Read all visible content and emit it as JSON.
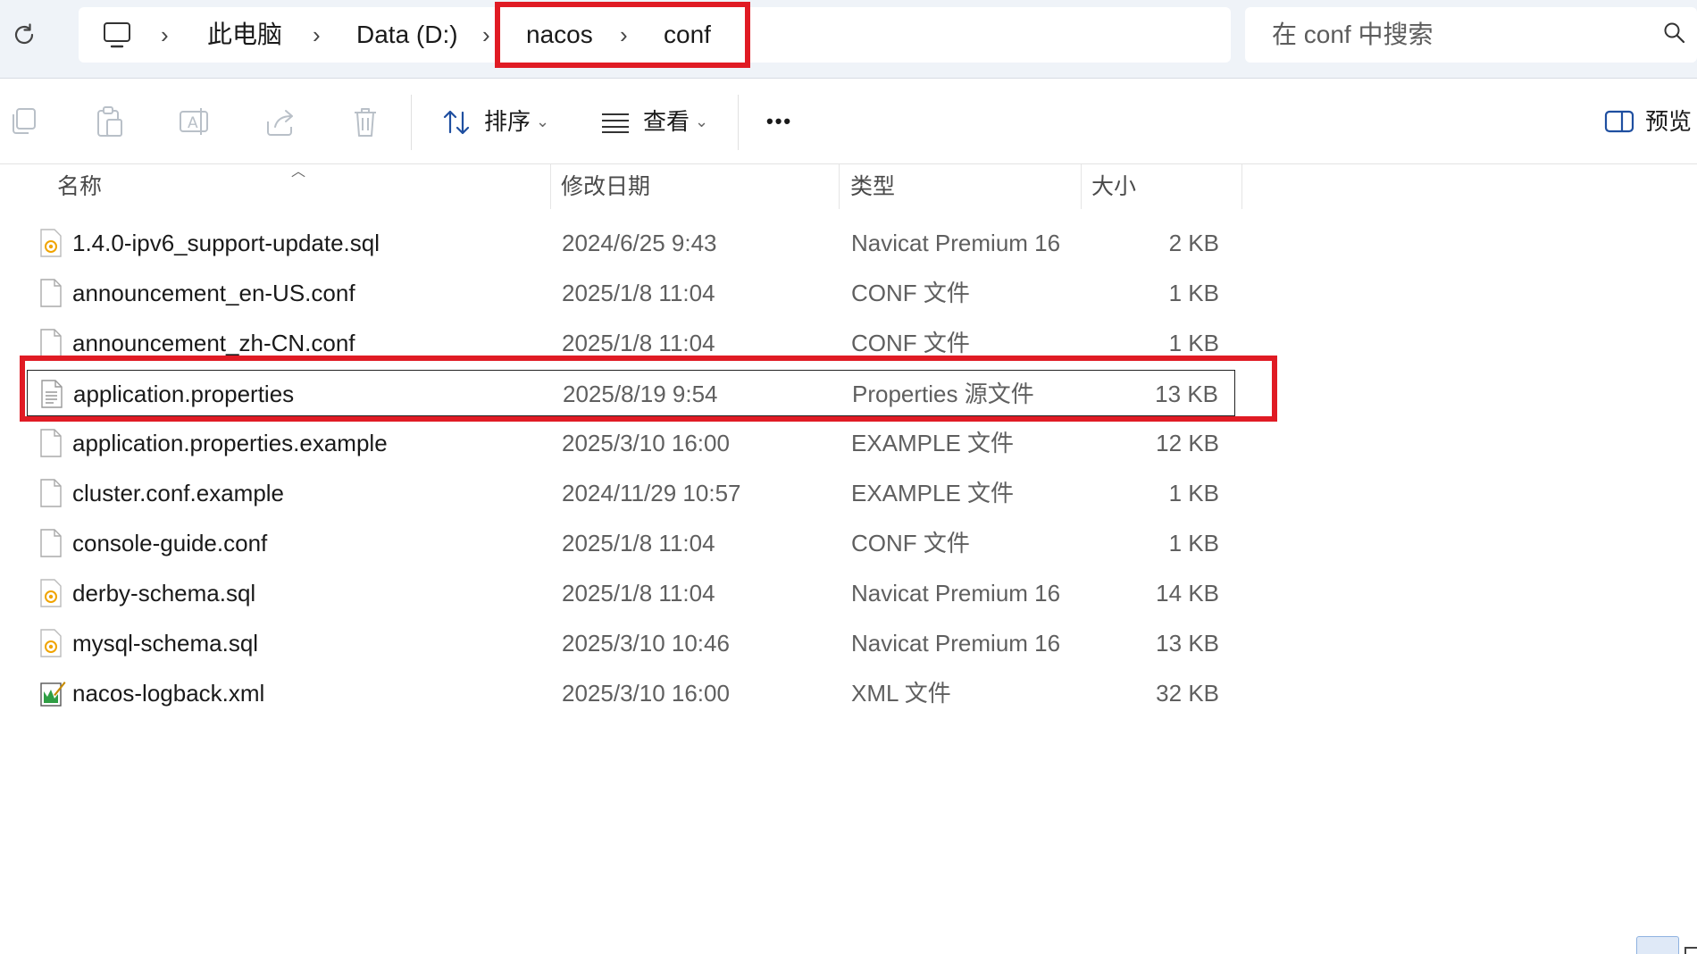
{
  "breadcrumb": {
    "items": [
      "此电脑",
      "Data (D:)",
      "nacos",
      "conf"
    ]
  },
  "search": {
    "placeholder": "在 conf 中搜索"
  },
  "toolbar": {
    "sort_label": "排序",
    "view_label": "查看",
    "more_label": "•••",
    "preview_label": "预览"
  },
  "columns": {
    "name": "名称",
    "date": "修改日期",
    "type": "类型",
    "size": "大小"
  },
  "files": [
    {
      "name": "1.4.0-ipv6_support-update.sql",
      "date": "2024/6/25 9:43",
      "type": "Navicat Premium 16",
      "size": "2 KB",
      "icon": "sql-file-icon"
    },
    {
      "name": "announcement_en-US.conf",
      "date": "2025/1/8 11:04",
      "type": "CONF 文件",
      "size": "1 KB",
      "icon": "blank-file-icon"
    },
    {
      "name": "announcement_zh-CN.conf",
      "date": "2025/1/8 11:04",
      "type": "CONF 文件",
      "size": "1 KB",
      "icon": "blank-file-icon"
    },
    {
      "name": "application.properties",
      "date": "2025/8/19 9:54",
      "type": "Properties 源文件",
      "size": "13 KB",
      "icon": "text-file-icon",
      "selected": true
    },
    {
      "name": "application.properties.example",
      "date": "2025/3/10 16:00",
      "type": "EXAMPLE 文件",
      "size": "12 KB",
      "icon": "blank-file-icon"
    },
    {
      "name": "cluster.conf.example",
      "date": "2024/11/29 10:57",
      "type": "EXAMPLE 文件",
      "size": "1 KB",
      "icon": "blank-file-icon"
    },
    {
      "name": "console-guide.conf",
      "date": "2025/1/8 11:04",
      "type": "CONF 文件",
      "size": "1 KB",
      "icon": "blank-file-icon"
    },
    {
      "name": "derby-schema.sql",
      "date": "2025/1/8 11:04",
      "type": "Navicat Premium 16",
      "size": "14 KB",
      "icon": "sql-file-icon"
    },
    {
      "name": "mysql-schema.sql",
      "date": "2025/3/10 10:46",
      "type": "Navicat Premium 16",
      "size": "13 KB",
      "icon": "sql-file-icon"
    },
    {
      "name": "nacos-logback.xml",
      "date": "2025/3/10 16:00",
      "type": "XML 文件",
      "size": "32 KB",
      "icon": "xml-file-icon"
    }
  ],
  "colors": {
    "highlight": "#e01b24",
    "toolbar_bg": "#eff3f8"
  }
}
